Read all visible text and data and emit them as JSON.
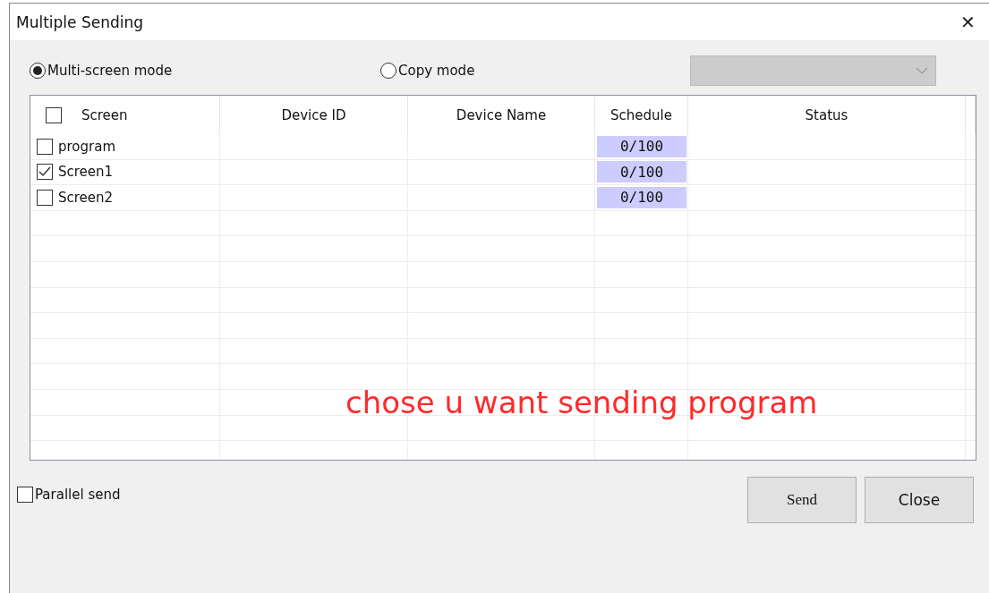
{
  "window": {
    "title": "Multiple Sending",
    "close": "✕"
  },
  "modes": [
    {
      "label": "Multi-screen mode",
      "selected": true
    },
    {
      "label": "Copy mode",
      "selected": false
    }
  ],
  "device_select": {
    "disabled": true
  },
  "table": {
    "select_all": {
      "checked": false
    },
    "columns": [
      "Screen",
      "Device ID",
      "Device Name",
      "Schedule",
      "Status"
    ],
    "rows": [
      {
        "screen": "program",
        "checked": false,
        "schedule": "0/100",
        "level": 0
      },
      {
        "screen": "Screen1",
        "checked": true,
        "schedule": "0/100",
        "level": 0
      },
      {
        "screen": "Screen2",
        "checked": false,
        "schedule": "0/100",
        "level": 0
      }
    ]
  },
  "annotation": "chose u want sending program",
  "parallel_send": {
    "label": "Parallel send",
    "checked": false
  },
  "buttons": [
    {
      "label": "Send",
      "kind": "serif"
    },
    {
      "label": "Close",
      "kind": "sans"
    }
  ]
}
